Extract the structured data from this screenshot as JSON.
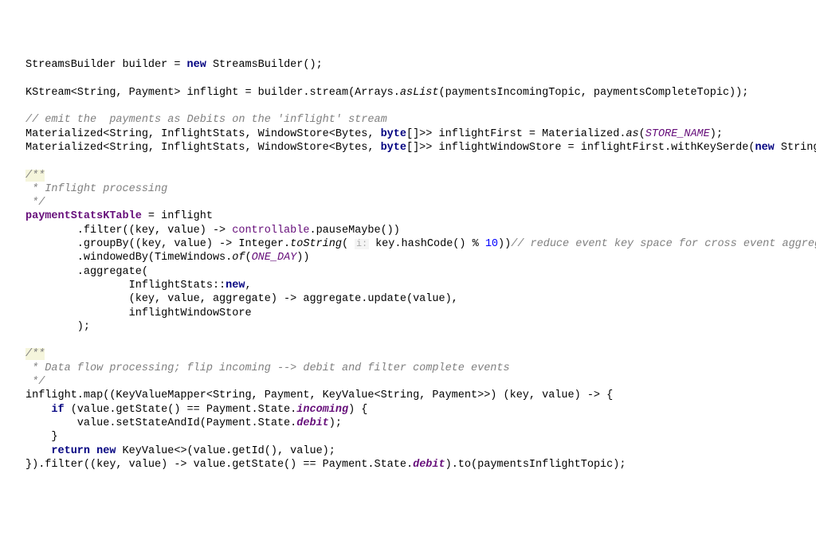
{
  "code": {
    "l1_a": "StreamsBuilder builder = ",
    "l1_new": "new",
    "l1_b": " StreamsBuilder();",
    "l3_a": "KStream<String, Payment> inflight = builder.stream(Arrays.",
    "l3_aslist": "asList",
    "l3_b": "(paymentsIncomingTopic, paymentsCompleteTopic));",
    "l5": "// emit the  payments as Debits on the 'inflight' stream",
    "l6_a": "Materialized<String, InflightStats, WindowStore<Bytes, ",
    "l6_byte": "byte",
    "l6_b": "[]>> inflightFirst = Materialized.",
    "l6_as": "as",
    "l6_c": "(",
    "l6_store": "STORE_NAME",
    "l6_d": ");",
    "l7_a": "Materialized<String, InflightStats, WindowStore<Bytes, ",
    "l7_byte": "byte",
    "l7_b": "[]>> inflightWindowStore = inflightFirst.withKeySerde(",
    "l7_new": "new",
    "l7_c": " String",
    "l9_docstart": "/**",
    "l10_doc": " * Inflight processing",
    "l11_doc": " */",
    "l12_field": "paymentStatsKTable",
    "l12_b": " = inflight",
    "l13_a": "        .filter((key, value) -> ",
    "l13_ctrl": "controllable",
    "l13_b": ".pauseMaybe())",
    "l14_a": "        .groupBy((key, value) -> Integer.",
    "l14_tostr": "toString",
    "l14_b": "( ",
    "l14_hint": "i:",
    "l14_c": " key.hashCode() % ",
    "l14_num": "10",
    "l14_d": "))",
    "l14_cmt": "// reduce event key space for cross event aggrega",
    "l15_a": "        .windowedBy(TimeWindows.",
    "l15_of": "of",
    "l15_b": "(",
    "l15_day": "ONE_DAY",
    "l15_c": "))",
    "l16": "        .aggregate(",
    "l17_a": "                InflightStats::",
    "l17_new": "new",
    "l17_b": ",",
    "l18": "                (key, value, aggregate) -> aggregate.update(value),",
    "l19": "                inflightWindowStore",
    "l20": "        );",
    "l22_docstart": "/**",
    "l23_doc": " * Data flow processing; flip incoming --> debit and filter complete events",
    "l24_doc": " */",
    "l25": "inflight.map((KeyValueMapper<String, Payment, KeyValue<String, Payment>>) (key, value) -> {",
    "l26_a": "    ",
    "l26_if": "if",
    "l26_b": " (value.getState() == Payment.State.",
    "l26_inc": "incoming",
    "l26_c": ") {",
    "l27_a": "        value.setStateAndId(Payment.State.",
    "l27_deb": "debit",
    "l27_b": ");",
    "l28": "    }",
    "l29_a": "    ",
    "l29_ret": "return",
    "l29_b": " ",
    "l29_new": "new",
    "l29_c": " KeyValue<>(value.getId(), value);",
    "l30_a": "}).filter((key, value) -> value.getState() == Payment.State.",
    "l30_deb": "debit",
    "l30_b": ").to(paymentsInflightTopic);"
  }
}
